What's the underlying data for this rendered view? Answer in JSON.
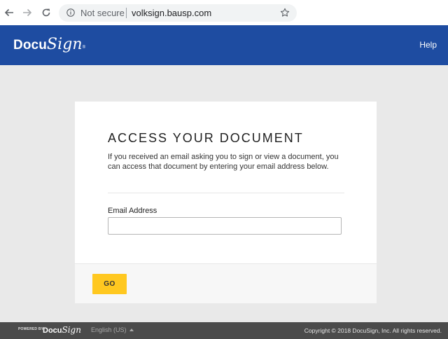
{
  "browser": {
    "security_label": "Not secure",
    "url": "volksign.bausp.com"
  },
  "header": {
    "logo_docu": "Docu",
    "logo_sign": "Sign",
    "logo_reg": "®",
    "help_label": "Help"
  },
  "card": {
    "title": "ACCESS YOUR DOCUMENT",
    "description": "If you received an email asking you to sign or view a document, you can access that document by entering your email address below.",
    "email_label": "Email Address",
    "email_value": "",
    "go_label": "GO"
  },
  "footer": {
    "powered_by": "POWERED BY",
    "logo_docu": "Docu",
    "logo_sign": "Sign",
    "language": "English (US)",
    "copyright": "Copyright © 2018 DocuSign, Inc. All rights reserved."
  },
  "colors": {
    "header_bg": "#1e4ca1",
    "go_button": "#ffc820",
    "footer_bg": "#4b4b4b",
    "page_bg": "#e9e9e9"
  },
  "icons": [
    "back-arrow-icon",
    "forward-arrow-icon",
    "reload-icon",
    "info-icon",
    "star-icon",
    "caret-up-icon"
  ]
}
